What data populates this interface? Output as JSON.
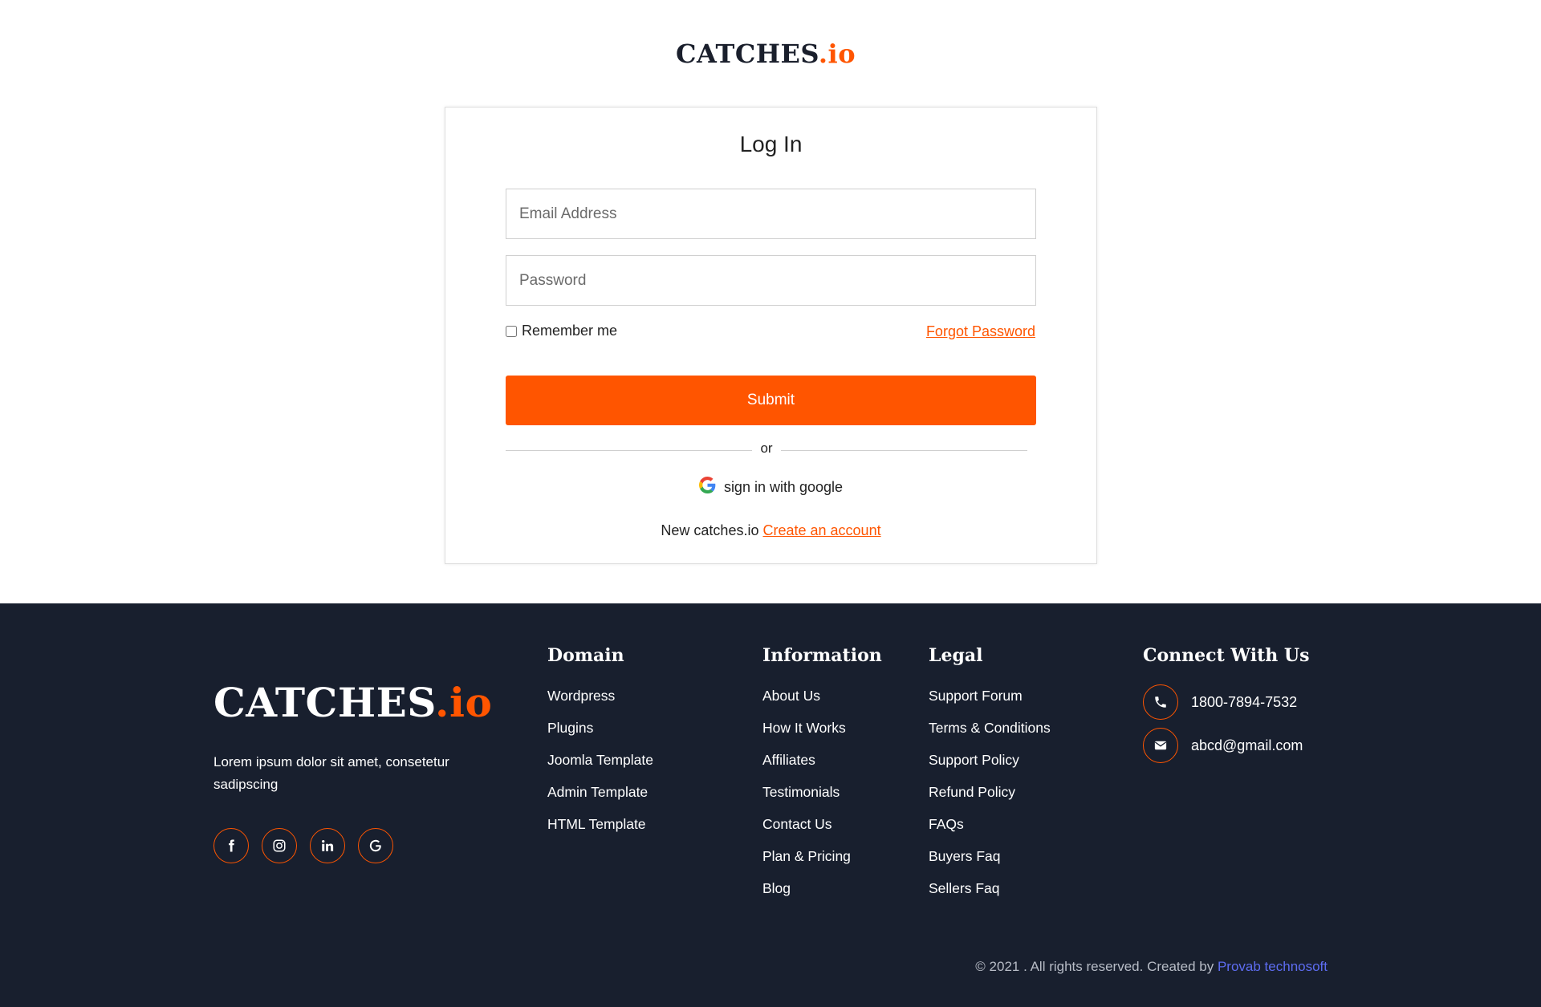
{
  "brand": {
    "name_main": "CATCHES",
    "name_accent": ".io"
  },
  "login": {
    "title": "Log In",
    "email_placeholder": "Email Address",
    "password_placeholder": "Password",
    "remember_label": "Remember me",
    "forgot_label": "Forgot Password",
    "submit_label": "Submit",
    "divider_label": "or",
    "google_label": "sign in with google",
    "new_text": "New catches.io",
    "create_label": "Create an account"
  },
  "footer": {
    "description": "Lorem ipsum dolor sit amet, consetetur sadipscing",
    "socials": [
      "facebook-icon",
      "instagram-icon",
      "linkedin-icon",
      "google-icon"
    ],
    "domain": {
      "title": "Domain",
      "items": [
        "Wordpress",
        "Plugins",
        "Joomla Template",
        "Admin Template",
        "HTML Template"
      ]
    },
    "information": {
      "title": "Information",
      "items": [
        "About Us",
        "How It Works",
        "Affiliates",
        "Testimonials",
        "Contact Us",
        "Plan & Pricing",
        "Blog"
      ]
    },
    "legal": {
      "title": "Legal",
      "items": [
        "Support Forum",
        "Terms & Conditions",
        "Support Policy",
        "Refund Policy",
        "FAQs",
        "Buyers Faq",
        "Sellers Faq"
      ]
    },
    "connect": {
      "title": "Connect With Us",
      "phone": "1800-7894-7532",
      "email": "abcd@gmail.com"
    },
    "copyright_text": "© 2021 . All rights reserved. Created by",
    "copyright_link": "Provab technosoft"
  },
  "colors": {
    "accent": "#ff5500",
    "footer_bg": "#181f2e",
    "link_blue": "#5d6cf0"
  }
}
